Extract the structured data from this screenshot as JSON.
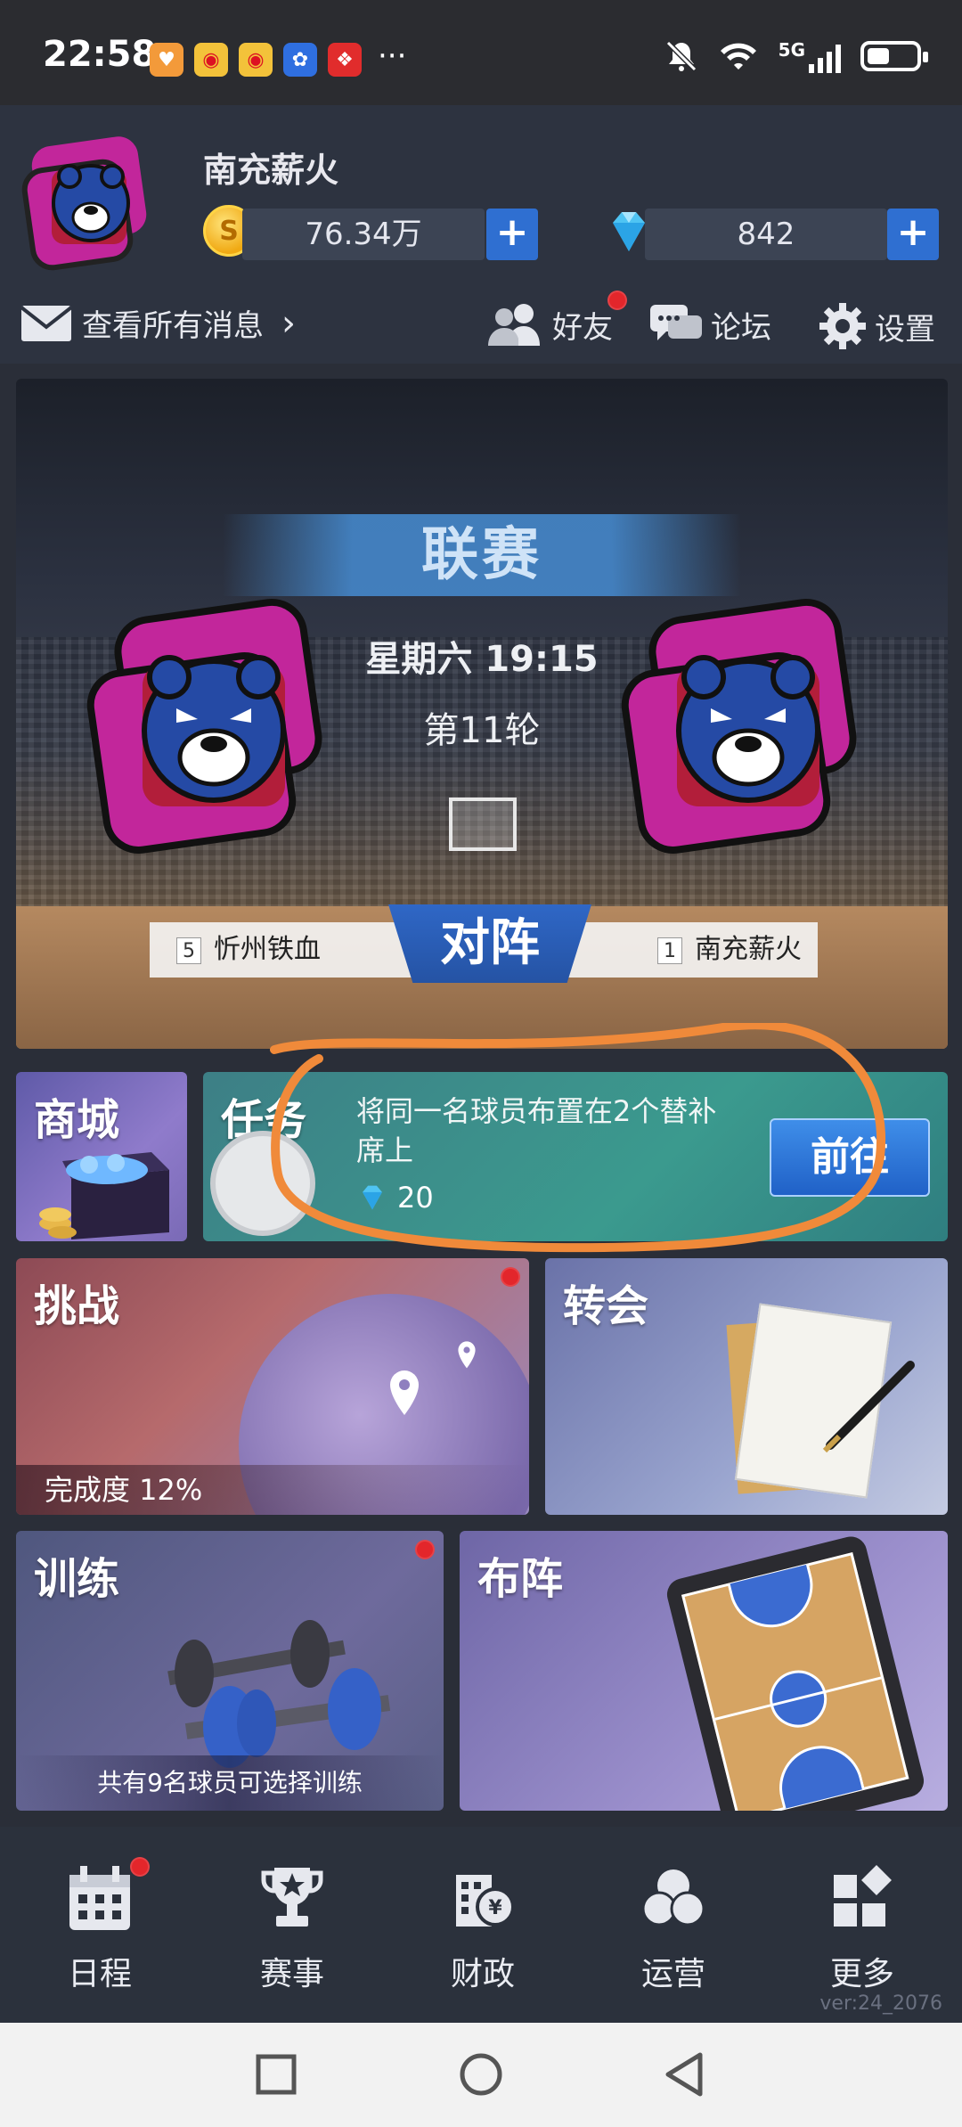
{
  "status_bar": {
    "time": "22:58",
    "dots": "···",
    "network": "5G"
  },
  "header": {
    "team_name": "南充薪火",
    "coins": "76.34万",
    "gems": "842",
    "plus": "+",
    "messages_label": "查看所有消息",
    "messages_chevron": "›",
    "friends_label": "好友",
    "forum_label": "论坛",
    "settings_label": "设置"
  },
  "match": {
    "league_label": "联赛",
    "time": "星期六 19:15",
    "round": "第11轮",
    "vs_label": "对阵",
    "home_rank": "5",
    "home_team": "忻州铁血",
    "away_rank": "1",
    "away_team": "南充薪火"
  },
  "tiles": {
    "shop": "商城",
    "task": "任务",
    "task_desc": "将同一名球员布置在2个替补席上",
    "task_reward": "20",
    "task_go": "前往",
    "challenge": "挑战",
    "challenge_progress": "完成度 12%",
    "transfer": "转会",
    "training": "训练",
    "training_info": "共有9名球员可选择训练",
    "formation": "布阵"
  },
  "bottom_nav": {
    "items": [
      {
        "label": "日程",
        "icon": "calendar-icon",
        "badge": true
      },
      {
        "label": "赛事",
        "icon": "trophy-icon",
        "badge": false
      },
      {
        "label": "财政",
        "icon": "finance-icon",
        "badge": false
      },
      {
        "label": "运营",
        "icon": "operations-icon",
        "badge": false
      },
      {
        "label": "更多",
        "icon": "more-icon",
        "badge": false
      }
    ],
    "version": "ver:24_2076"
  },
  "colors": {
    "accent_blue": "#2f6fd1",
    "badge_red": "#e3262b",
    "annotation_orange": "#f08a3a",
    "team_magenta": "#c2269b"
  }
}
